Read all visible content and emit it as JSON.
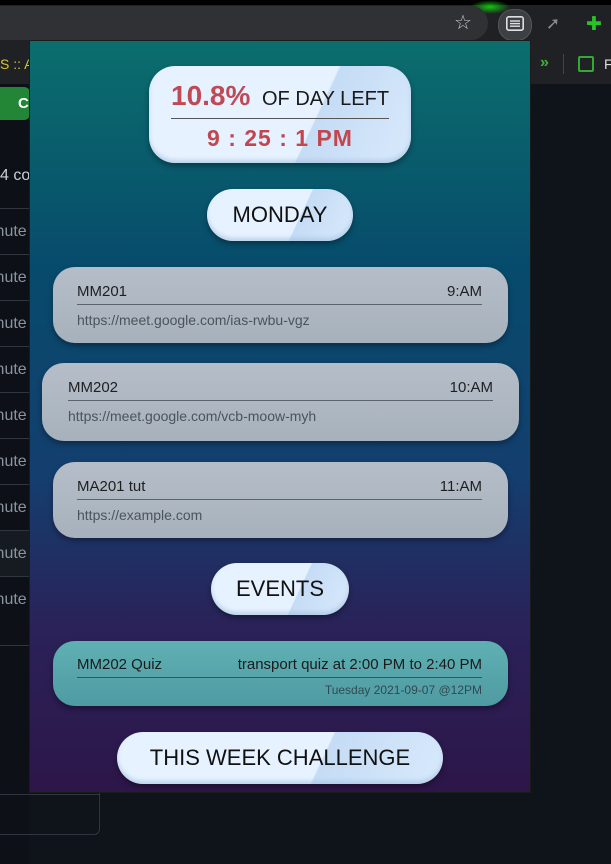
{
  "browser": {
    "bookmark_left": "S :: Ac",
    "bookmark_chevron": "»",
    "bookmark_right": "F"
  },
  "background_page": {
    "button_label": "C",
    "count_text": "4 co",
    "rows": [
      "inute",
      "inute",
      "inute",
      "inute",
      "inute",
      "inute",
      "inute",
      "inute",
      "inute"
    ]
  },
  "clock": {
    "percent": "10.8%",
    "label": "OF DAY LEFT",
    "time": "9 : 25 : 1  PM"
  },
  "day": "MONDAY",
  "classes": [
    {
      "name": "MM201",
      "time": "9:AM",
      "url": "https://meet.google.com/ias-rwbu-vgz"
    },
    {
      "name": "MM202",
      "time": "10:AM",
      "url": "https://meet.google.com/vcb-moow-myh"
    },
    {
      "name": "MA201 tut",
      "time": "11:AM",
      "url": "https://example.com"
    }
  ],
  "events_heading": "EVENTS",
  "events": [
    {
      "name": "MM202 Quiz",
      "description": "transport quiz at 2:00 PM to 2:40 PM",
      "date": "Tuesday 2021-09-07 @12PM"
    }
  ],
  "challenge_heading": "THIS WEEK CHALLENGE",
  "colors": {
    "accent_red": "#bf4a55",
    "event_card": "#5fb0b3",
    "class_card": "#b5bec8",
    "extension_green": "#29c229"
  }
}
